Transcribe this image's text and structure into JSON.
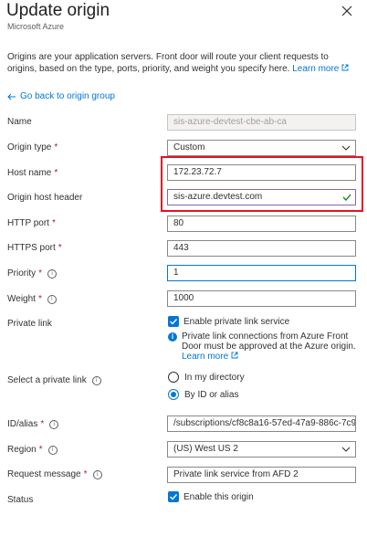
{
  "header": {
    "title": "Update origin",
    "subtitle": "Microsoft Azure"
  },
  "description": {
    "text": "Origins are your application servers. Front door will route your client requests to origins, based on the type, ports, priority, and weight you specify here.",
    "learn_more": "Learn more"
  },
  "back_link": "Go back to origin group",
  "form": {
    "name": {
      "label": "Name",
      "value": "sis-azure-devtest-cbe-ab-ca"
    },
    "origin_type": {
      "label": "Origin type",
      "value": "Custom"
    },
    "host_name": {
      "label": "Host name",
      "value": "172.23.72.7"
    },
    "origin_host_header": {
      "label": "Origin host header",
      "value": "sis-azure.devtest.com"
    },
    "http_port": {
      "label": "HTTP port",
      "value": "80"
    },
    "https_port": {
      "label": "HTTPS port",
      "value": "443"
    },
    "priority": {
      "label": "Priority",
      "value": "1"
    },
    "weight": {
      "label": "Weight",
      "value": "1000"
    },
    "private_link": {
      "label": "Private link",
      "checkbox_label": "Enable private link service",
      "checked": true,
      "info": "Private link connections from Azure Front Door must be approved at the Azure origin.",
      "learn_more": "Learn more"
    },
    "select_private_link": {
      "label": "Select a private link",
      "options": [
        "In my directory",
        "By ID or alias"
      ],
      "selected": "By ID or alias"
    },
    "id_alias": {
      "label": "ID/alias",
      "value": "/subscriptions/cf8c8a16-57ed-47a9-886c-7c98..."
    },
    "region": {
      "label": "Region",
      "value": "(US) West US 2"
    },
    "request_message": {
      "label": "Request message",
      "value": "Private link service from AFD 2"
    },
    "status": {
      "label": "Status",
      "checkbox_label": "Enable this origin",
      "checked": true
    }
  },
  "colors": {
    "accent": "#0078d4",
    "required": "#a4262c",
    "highlight": "#e81123"
  }
}
